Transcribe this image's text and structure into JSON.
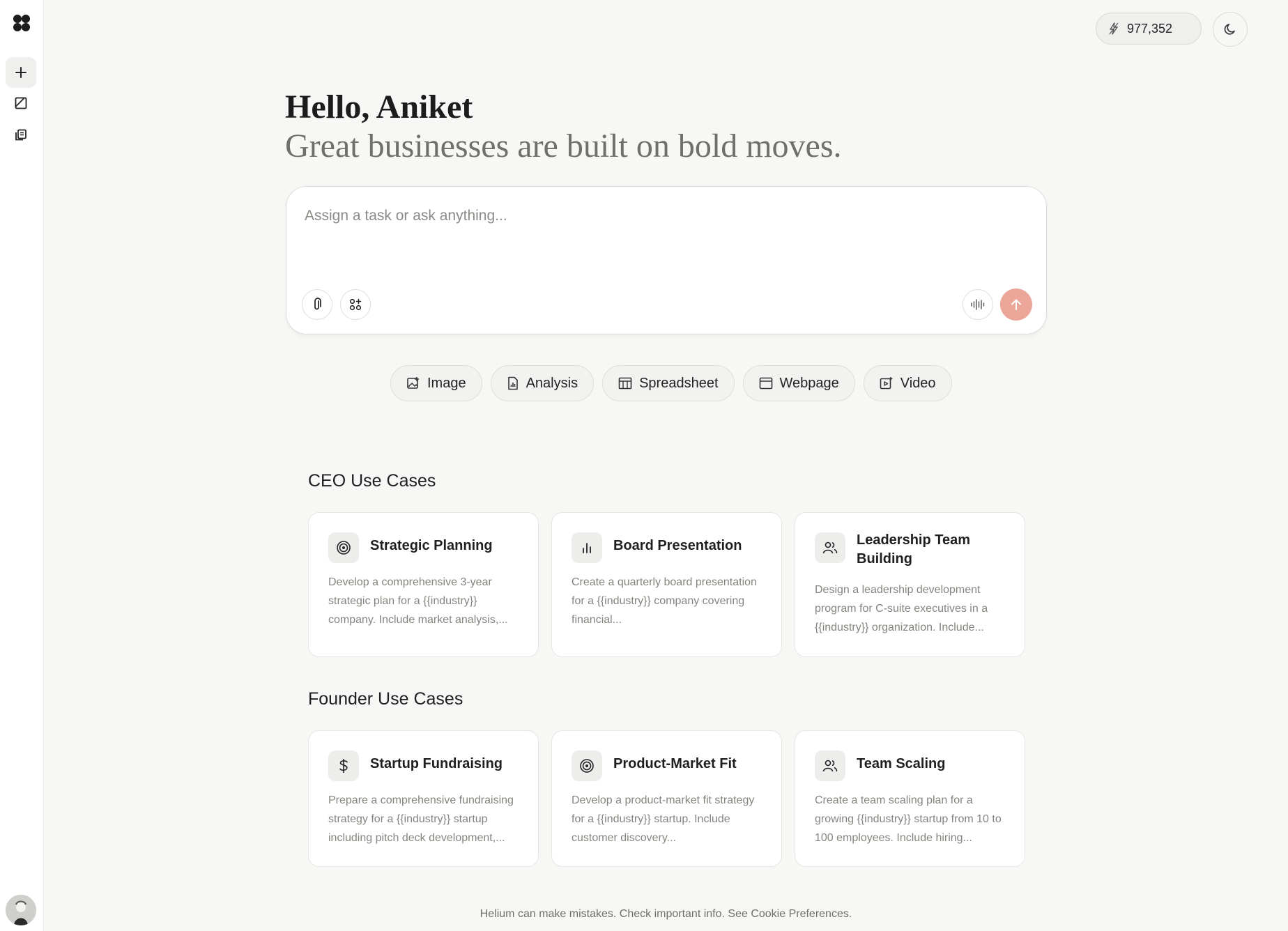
{
  "sidebar": {
    "logo_icon": "helium-logo-icon",
    "new_task_icon": "plus-icon",
    "item2_icon": "panel-icon",
    "item3_icon": "library-icon"
  },
  "header": {
    "credits_value": "977,352",
    "credits_icon": "lightning-icon",
    "theme_icon": "moon-icon"
  },
  "greeting": {
    "title": "Hello, Aniket",
    "subtitle": "Great businesses are built on bold moves."
  },
  "prompt": {
    "placeholder": "Assign a task or ask anything...",
    "send_color": "#eca599"
  },
  "chips": [
    {
      "label": "Image",
      "icon": "image-icon"
    },
    {
      "label": "Analysis",
      "icon": "analysis-icon"
    },
    {
      "label": "Spreadsheet",
      "icon": "spreadsheet-icon"
    },
    {
      "label": "Webpage",
      "icon": "webpage-icon"
    },
    {
      "label": "Video",
      "icon": "video-icon"
    }
  ],
  "ceo": {
    "title": "CEO Use Cases",
    "cards": [
      {
        "title": "Strategic Planning",
        "icon": "target-icon",
        "desc": "Develop a comprehensive 3-year strategic plan for a {{industry}} company. Include market analysis,..."
      },
      {
        "title": "Board Presentation",
        "icon": "bar-chart-icon",
        "desc": "Create a quarterly board presentation for a {{industry}} company covering financial..."
      },
      {
        "title": "Leadership Team Building",
        "icon": "users-icon",
        "desc": "Design a leadership development program for C-suite executives in a {{industry}} organization. Include..."
      }
    ]
  },
  "founder": {
    "title": "Founder Use Cases",
    "cards": [
      {
        "title": "Startup Fundraising",
        "icon": "dollar-icon",
        "desc": "Prepare a comprehensive fundraising strategy for a {{industry}} startup including pitch deck development,..."
      },
      {
        "title": "Product-Market Fit",
        "icon": "target-icon",
        "desc": "Develop a product-market fit strategy for a {{industry}} startup. Include customer discovery..."
      },
      {
        "title": "Team Scaling",
        "icon": "users-icon",
        "desc": "Create a team scaling plan for a growing {{industry}} startup from 10 to 100 employees. Include hiring..."
      }
    ]
  },
  "footer": {
    "text": "Helium can make mistakes. Check important info. See Cookie Preferences."
  }
}
